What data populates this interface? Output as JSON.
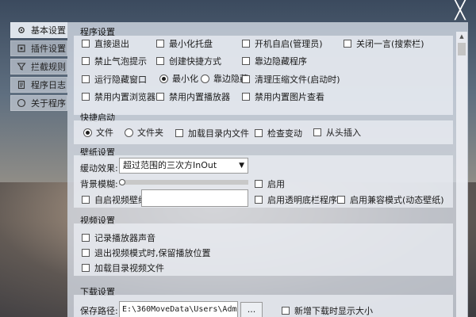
{
  "window": {
    "close_label": "╳"
  },
  "sidebar": {
    "items": [
      {
        "label": "基本设置",
        "icon": "gear-icon",
        "active": true
      },
      {
        "label": "插件设置",
        "icon": "plugin-icon",
        "active": false
      },
      {
        "label": "拦截规则",
        "icon": "filter-icon",
        "active": false
      },
      {
        "label": "程序日志",
        "icon": "document-icon",
        "active": false
      },
      {
        "label": "关于程序",
        "icon": "info-icon",
        "active": false
      }
    ]
  },
  "program_settings": {
    "title": "程序设置",
    "direct_exit": "直接退出",
    "minimize_tray": "最小化托盘",
    "autostart_admin": "开机自启(管理员)",
    "close_sentence": "关闭一言(搜索栏)",
    "disable_bubble": "禁止气泡提示",
    "create_shortcut": "创建快捷方式",
    "edge_hide_program": "靠边隐藏程序",
    "run_hide_window": "运行隐藏窗口",
    "radio_minimize": "最小化",
    "radio_edge_hide": "靠边隐藏",
    "clean_compressed": "清理压缩文件(启动时)",
    "disable_builtin_browser": "禁用内置浏览器",
    "disable_builtin_player": "禁用内置播放器",
    "disable_builtin_image": "禁用内置图片查看"
  },
  "quick_launch": {
    "title": "快捷启动",
    "radio_file": "文件",
    "radio_folder": "文件夹",
    "load_dir_files": "加载目录内文件",
    "check_changes": "检查变动",
    "insert_at_start": "从头插入"
  },
  "wallpaper": {
    "title": "壁纸设置",
    "easing_label": "缓动效果:",
    "easing_value": "超过范围的三次方InOut",
    "blur_label": "背景模糊:",
    "blur_level": 0.0,
    "enable_label": "启用",
    "autostart_video": "自启视频壁纸",
    "transparent_start": "启用透明底栏程序",
    "compat_mode": "启用兼容模式(动态壁纸)"
  },
  "video": {
    "title": "视频设置",
    "record_sound": "记录播放器声音",
    "keep_position": "退出视频模式时,保留播放位置",
    "load_dir_videos": "加载目录视频文件"
  },
  "download": {
    "title": "下载设置",
    "save_path_label": "保存路径:",
    "save_path_value": "E:\\360MoveData\\Users\\Adm",
    "browse_label": "...",
    "show_size": "新增下载时显示大小"
  }
}
